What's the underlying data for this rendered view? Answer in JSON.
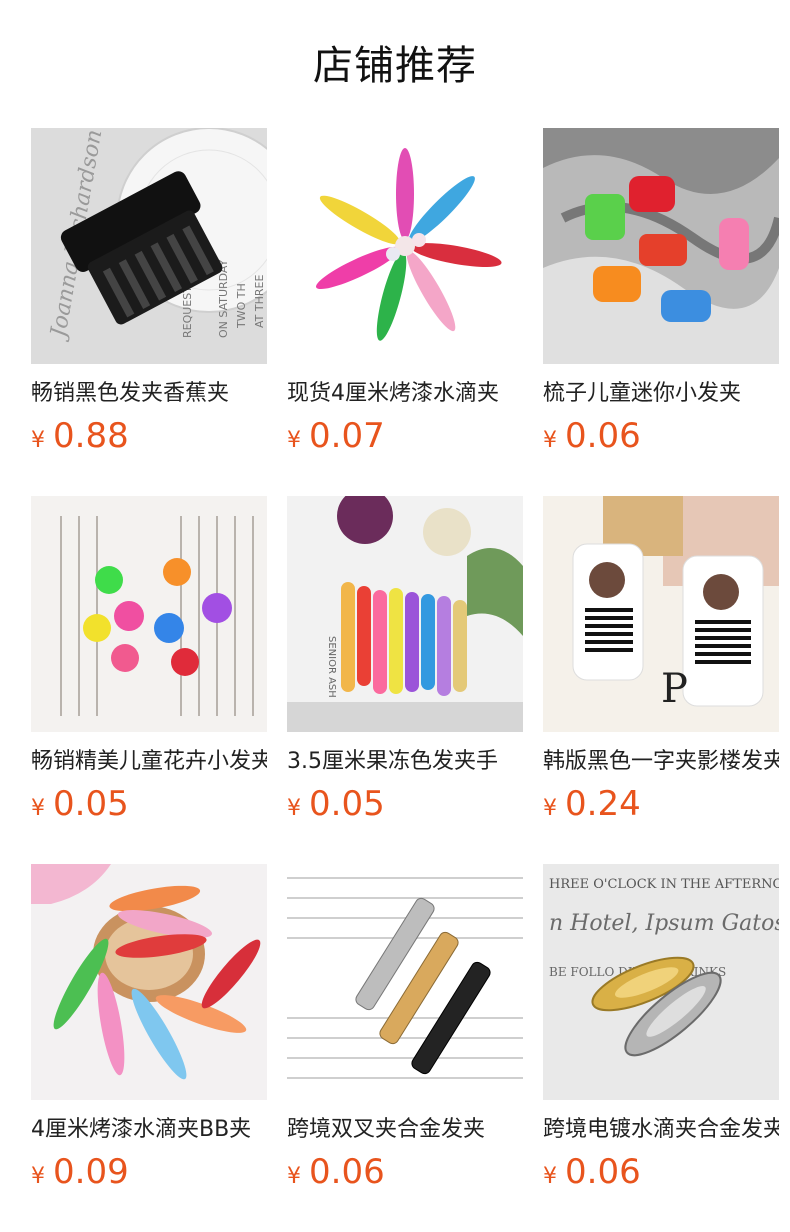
{
  "header": {
    "title": "店铺推荐"
  },
  "accent_color": "#e8541d",
  "products": [
    {
      "name": "畅销黑色发夹香蕉夹",
      "currency": "¥",
      "price": "0.88",
      "image": "black-claw-clip-image"
    },
    {
      "name": "现货4厘米烤漆水滴夹",
      "currency": "¥",
      "price": "0.07",
      "image": "colorful-snap-clips-image"
    },
    {
      "name": "梳子儿童迷你小发夹",
      "currency": "¥",
      "price": "0.06",
      "image": "mini-comb-clips-image"
    },
    {
      "name": "畅销精美儿童花卉小发夹",
      "currency": "¥",
      "price": "0.05",
      "image": "flower-clips-image"
    },
    {
      "name": "3.5厘米果冻色发夹手",
      "currency": "¥",
      "price": "0.05",
      "image": "jelly-color-clips-image"
    },
    {
      "name": "韩版黑色一字夹影楼发夹",
      "currency": "¥",
      "price": "0.24",
      "image": "black-bobby-pins-card-image"
    },
    {
      "name": "4厘米烤漆水滴夹BB夹",
      "currency": "¥",
      "price": "0.09",
      "image": "painted-teardrop-clips-image"
    },
    {
      "name": "跨境双叉夹合金发夹",
      "currency": "¥",
      "price": "0.06",
      "image": "alloy-duckbill-clips-image"
    },
    {
      "name": "跨境电镀水滴夹合金发夹",
      "currency": "¥",
      "price": "0.06",
      "image": "plated-snap-clips-image"
    }
  ]
}
